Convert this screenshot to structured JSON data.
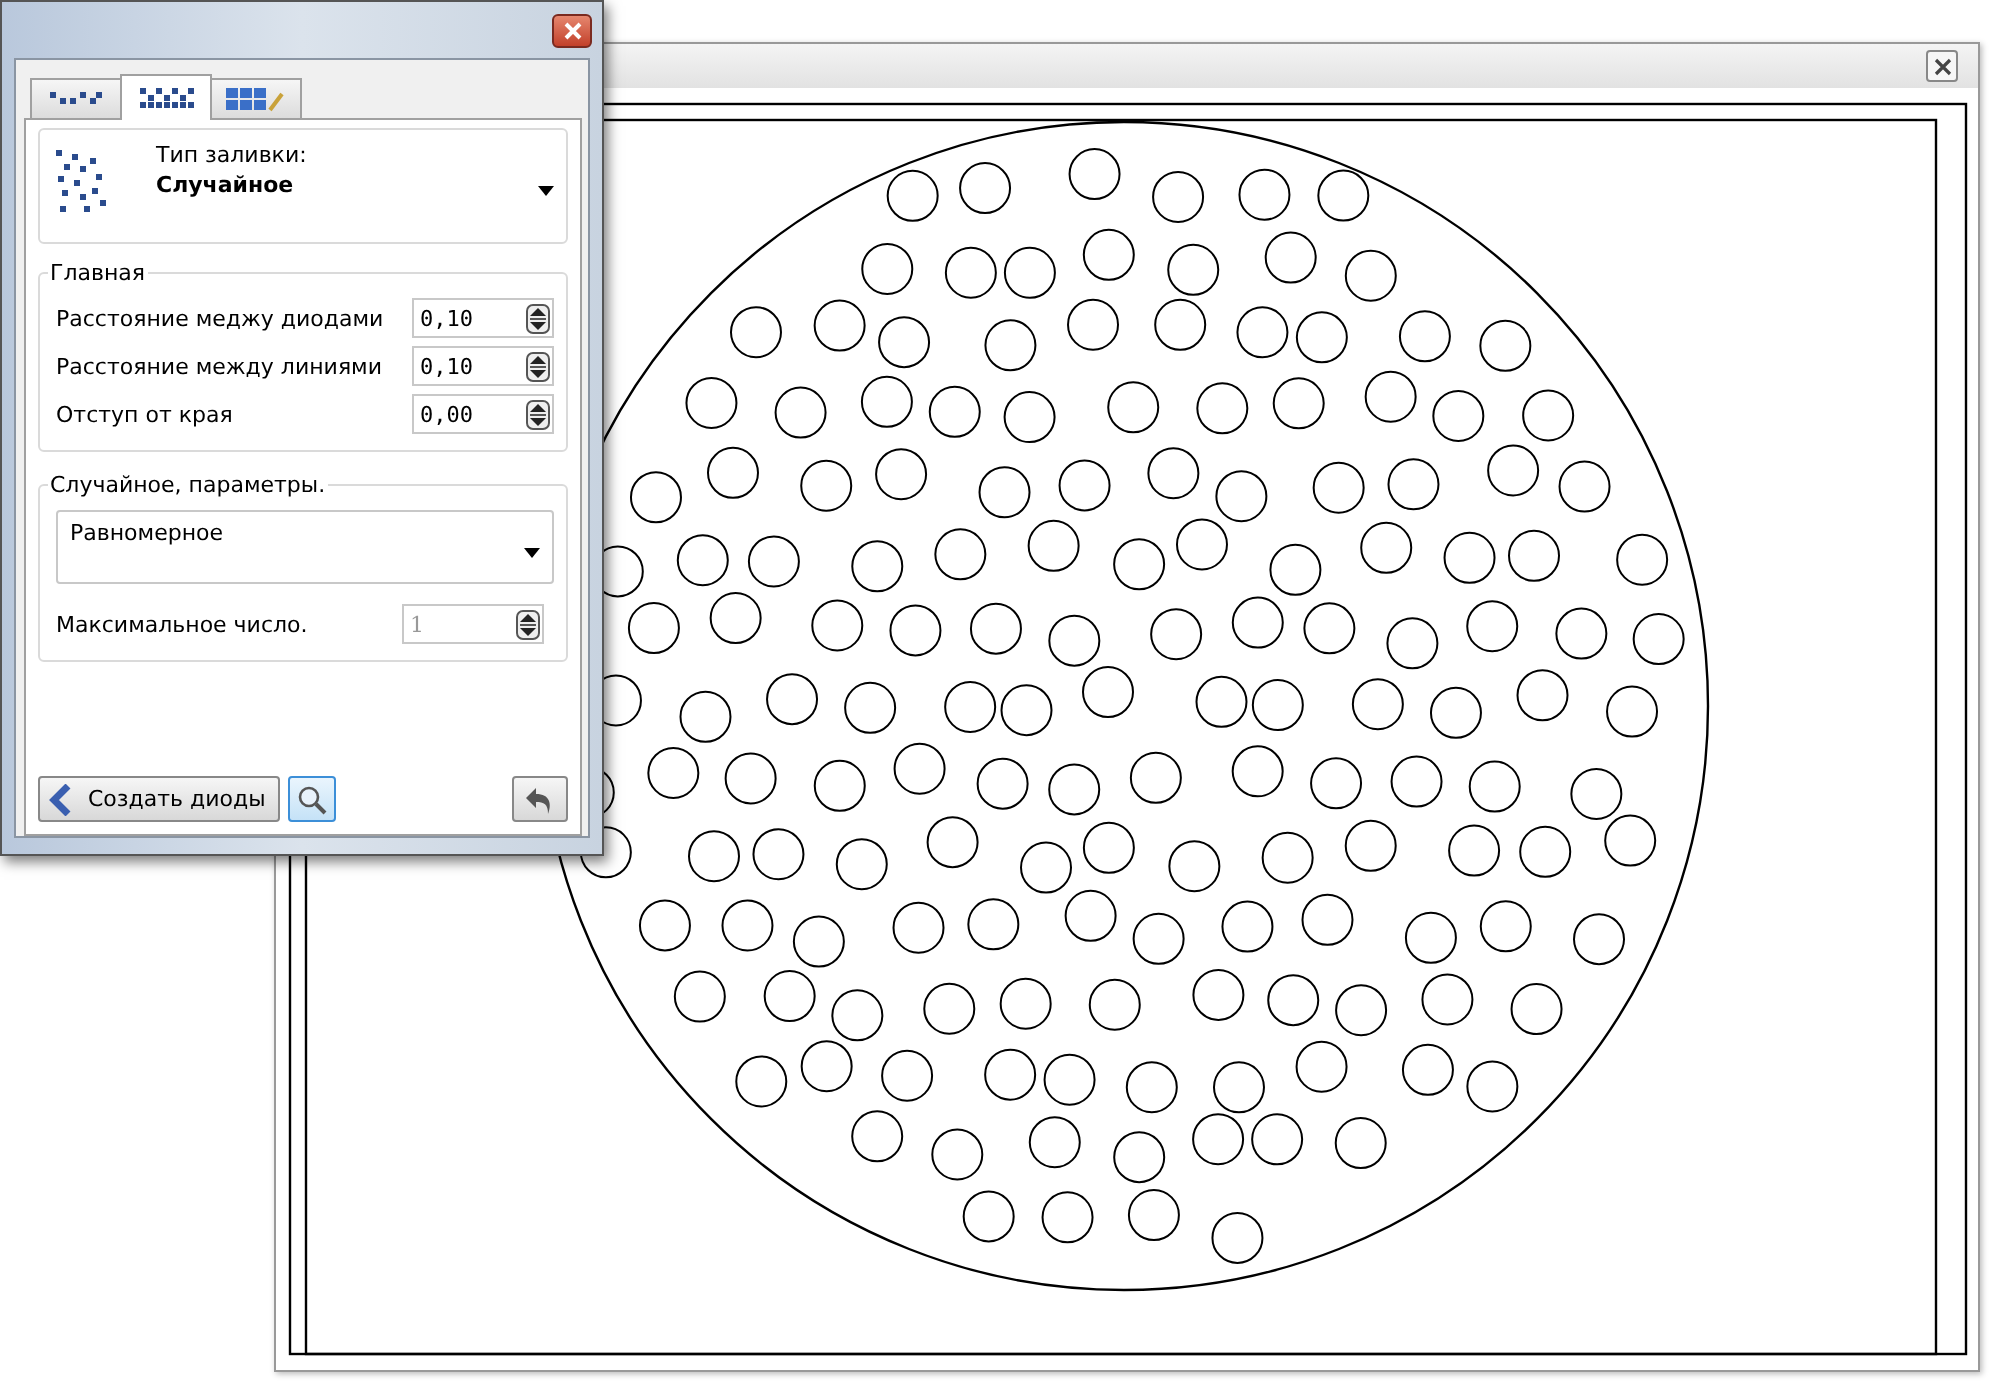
{
  "dialog": {
    "tabs": [
      {
        "kind": "dots",
        "selected": false
      },
      {
        "kind": "pattern",
        "selected": true
      },
      {
        "kind": "grid-edit",
        "selected": false
      }
    ],
    "fill_type": {
      "label": "Тип заливки:",
      "value": "Случайное"
    },
    "main_group": {
      "title": "Главная",
      "fields": [
        {
          "label": "Расстояние меджу диодами",
          "value": "0,10"
        },
        {
          "label": "Расстояние между линиями",
          "value": "0,10"
        },
        {
          "label": "Отступ от края",
          "value": "0,00"
        }
      ]
    },
    "random_group": {
      "title": "Случайное, параметры.",
      "distribution": "Равномерное",
      "max_label": "Максимальное число.",
      "max_value": "1",
      "max_disabled": true
    },
    "create_button": "Создать диоды"
  }
}
